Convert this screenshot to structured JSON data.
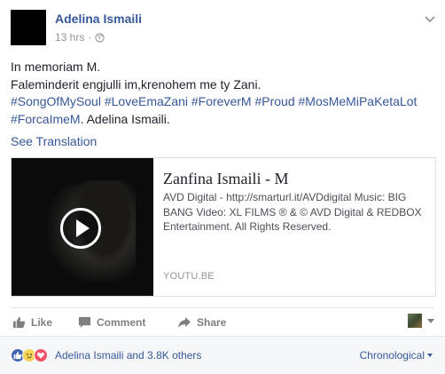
{
  "post": {
    "author": "Adelina Ismaili",
    "timestamp": "13 hrs",
    "privacy_icon": "globe-icon",
    "lines": [
      "In memoriam M.",
      "Faleminderit engjulli im,krenohem me ty Zani."
    ],
    "hashtags_line1": "#SongOfMySoul #LoveEmaZani #ForeverM #Proud #MosMeMiPaKetaLot",
    "hashtags_line2": "#ForcaImeM",
    "signature": ". Adelina Ismaili.",
    "see_translation": "See Translation"
  },
  "link_card": {
    "title": "Zanfina Ismaili - M",
    "description": "AVD Digital - http://smarturl.it/AVDdigital Music: BIG BANG Video: XL FILMS ® & © AVD Digital & REDBOX Entertainment. All Rights Reserved.",
    "domain": "YOUTU.BE"
  },
  "actions": {
    "like": "Like",
    "comment": "Comment",
    "share": "Share"
  },
  "reactions": {
    "names": "Adelina Ismaili and 3.8K others",
    "sort": "Chronological",
    "icons": [
      "like-icon",
      "sad-icon",
      "love-icon"
    ]
  },
  "colors": {
    "link": "#365899",
    "like": "#4267b2",
    "love": "#f25268",
    "sad": "#f7d358"
  }
}
